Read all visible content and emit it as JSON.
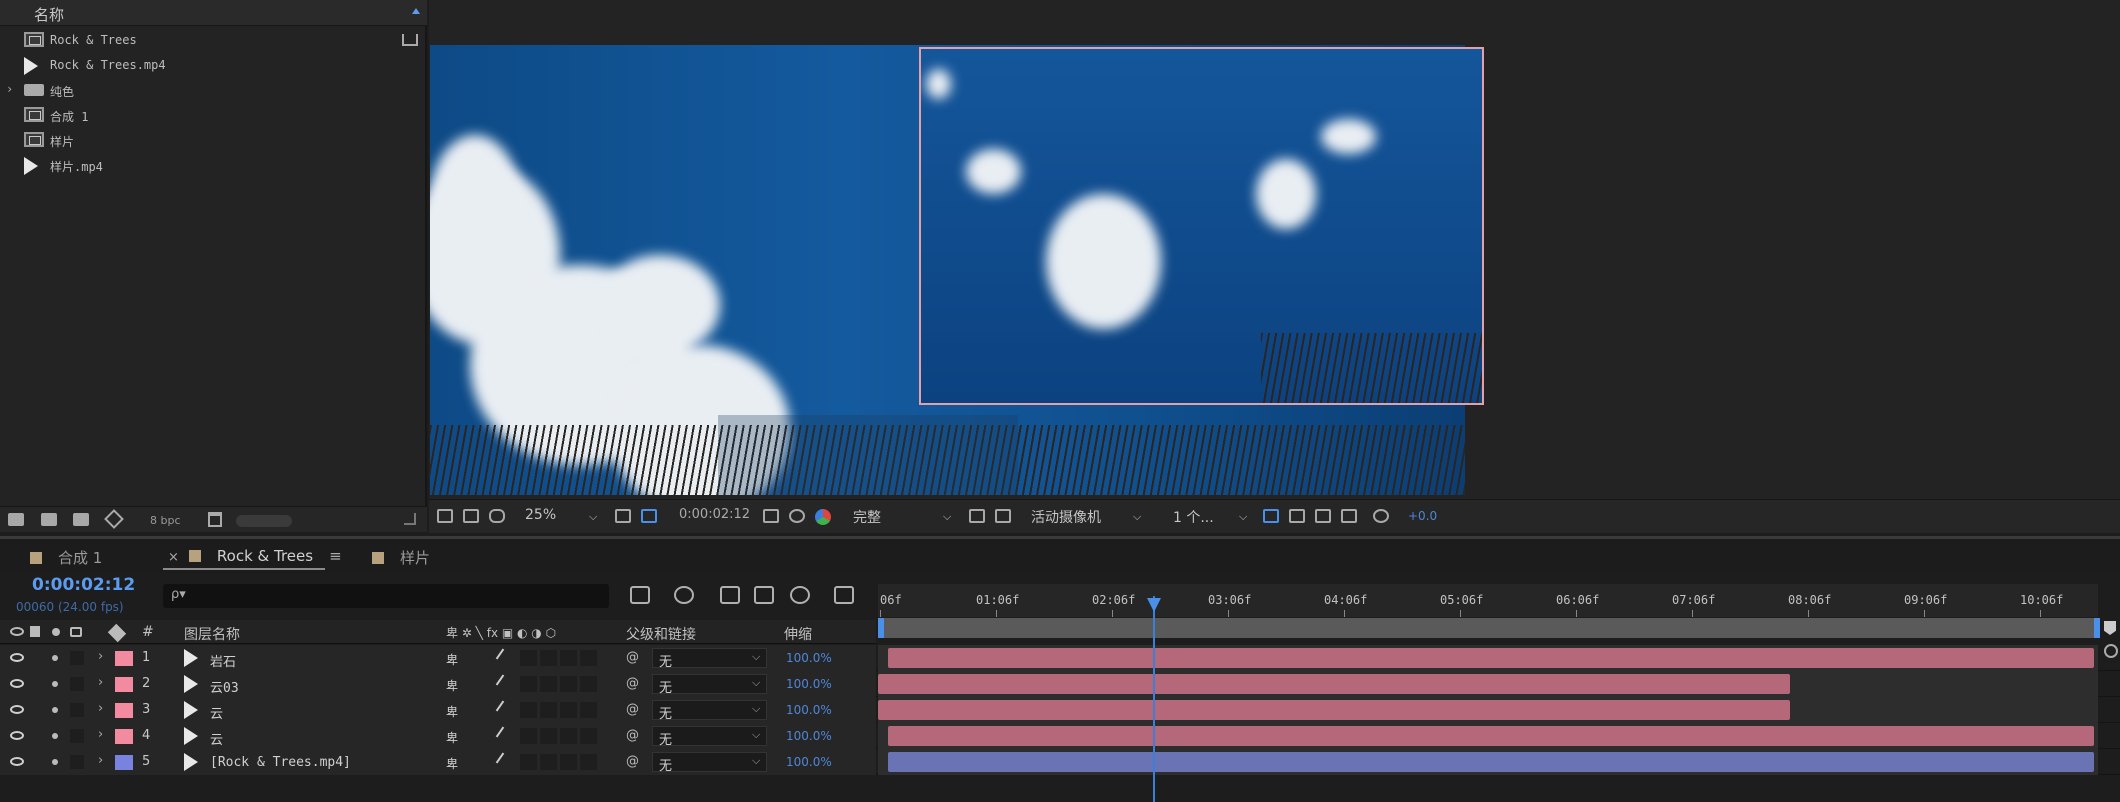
{
  "project": {
    "header": "名称",
    "items": [
      {
        "icon": "composition-icon",
        "name": "Rock & Trees"
      },
      {
        "icon": "footage-icon",
        "name": "Rock & Trees.mp4"
      },
      {
        "icon": "folder-icon",
        "name": "纯色"
      },
      {
        "icon": "composition-icon",
        "name": "合成 1"
      },
      {
        "icon": "composition-icon",
        "name": "样片"
      },
      {
        "icon": "footage-icon",
        "name": "样片.mp4"
      }
    ],
    "footer": {
      "bpc": "8 bpc"
    }
  },
  "viewer": {
    "zoom": "25%",
    "time": "0:00:02:12",
    "resolution": "完整",
    "camera": "活动摄像机",
    "views": "1 个...",
    "exposure": "+0.0"
  },
  "timeline": {
    "tabs": [
      {
        "label": "合成 1",
        "color": "#b8a27e",
        "active": false,
        "closable": false
      },
      {
        "label": "Rock & Trees",
        "color": "#b8a27e",
        "active": true,
        "closable": true
      },
      {
        "label": "样片",
        "color": "#b8a27e",
        "active": false,
        "closable": false
      }
    ],
    "timecode": "0:00:02:12",
    "frame_info": "00060 (24.00 fps)",
    "search_placeholder": "ρ▾",
    "ruler": [
      "06f",
      "01:06f",
      "02:06f",
      "03:06f",
      "04:06f",
      "05:06f",
      "06:06f",
      "07:06f",
      "08:06f",
      "09:06f",
      "10:06f"
    ],
    "headers": {
      "num": "#",
      "name": "图层名称",
      "parent": "父级和链接",
      "stretch": "伸缩"
    },
    "layers": [
      {
        "num": "1",
        "name": "岩石",
        "label_color": "#f28aa0",
        "parent": "无",
        "stretch": "100.0%",
        "bar_color": "#b4687a",
        "bar_end": 1.0
      },
      {
        "num": "2",
        "name": "云03",
        "label_color": "#f28aa0",
        "parent": "无",
        "stretch": "100.0%",
        "bar_color": "#b4687a",
        "bar_end": 0.75
      },
      {
        "num": "3",
        "name": "云",
        "label_color": "#f28aa0",
        "parent": "无",
        "stretch": "100.0%",
        "bar_color": "#b4687a",
        "bar_end": 0.75
      },
      {
        "num": "4",
        "name": "云",
        "label_color": "#f28aa0",
        "parent": "无",
        "stretch": "100.0%",
        "bar_color": "#b4687a",
        "bar_end": 1.0
      },
      {
        "num": "5",
        "name": "[Rock & Trees.mp4]",
        "label_color": "#7a82e0",
        "parent": "无",
        "stretch": "100.0%",
        "bar_color": "#6a74b4",
        "bar_end": 1.0
      }
    ]
  }
}
